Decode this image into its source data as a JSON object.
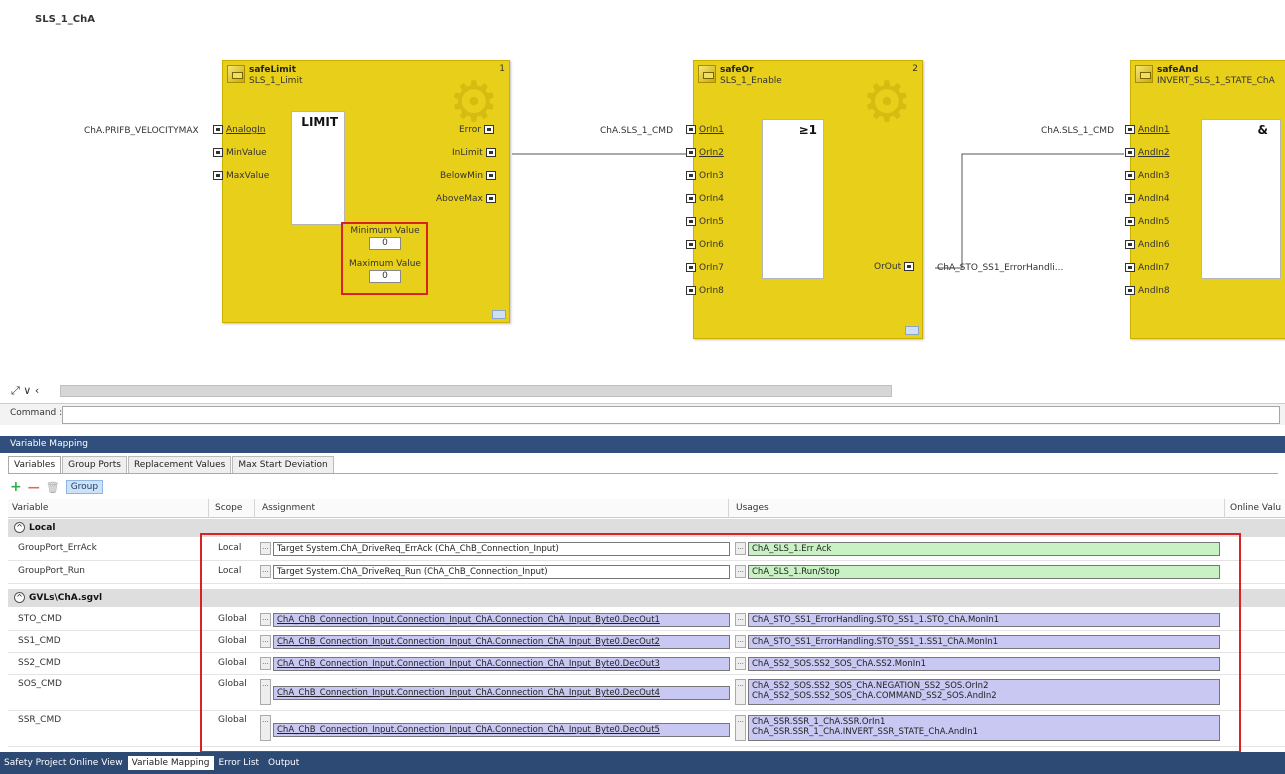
{
  "diagram": {
    "sheet_title": "SLS_1_ChA",
    "blocks": [
      {
        "type": "safeLimit",
        "instance": "SLS_1_Limit",
        "number": "1",
        "core_label": "LIMIT",
        "inputs": [
          "AnalogIn",
          "MinValue",
          "MaxValue"
        ],
        "outputs": [
          "Error",
          "InLimit",
          "BelowMin",
          "AboveMax"
        ],
        "params": [
          {
            "label": "Minimum Value",
            "value": "0"
          },
          {
            "label": "Maximum Value",
            "value": "0"
          }
        ],
        "input_connections": [
          "ChA.PRIFB_VELOCITYMAX"
        ]
      },
      {
        "type": "safeOr",
        "instance": "SLS_1_Enable",
        "number": "2",
        "core_label": "≥1",
        "inputs": [
          "OrIn1",
          "OrIn2",
          "OrIn3",
          "OrIn4",
          "OrIn5",
          "OrIn6",
          "OrIn7",
          "OrIn8"
        ],
        "output": "OrOut",
        "input_connections": [
          "ChA.SLS_1_CMD"
        ],
        "output_connection": "ChA_STO_SS1_ErrorHandli..."
      },
      {
        "type": "safeAnd",
        "instance": "INVERT_SLS_1_STATE_ChA",
        "core_label": "&",
        "inputs": [
          "AndIn1",
          "AndIn2",
          "AndIn3",
          "AndIn4",
          "AndIn5",
          "AndIn6",
          "AndIn7",
          "AndIn8"
        ],
        "input_connections": [
          "ChA.SLS_1_CMD"
        ]
      }
    ]
  },
  "command": {
    "label": "Command :"
  },
  "panel": {
    "title": "Variable Mapping",
    "tabs": [
      "Variables",
      "Group Ports",
      "Replacement Values",
      "Max Start Deviation"
    ],
    "toolbar": {
      "add_icon": "+",
      "remove_icon": "—",
      "delete_icon": "🗑",
      "group_label": "Group"
    },
    "columns": [
      "Variable",
      "Scope",
      "Assignment",
      "Usages",
      "Online Valu"
    ],
    "groups": [
      {
        "name": "Local",
        "toggle": "^",
        "rows": [
          {
            "variable": "GroupPort_ErrAck",
            "scope": "Local",
            "assignment": "Target System.ChA_DriveReq_ErrAck (ChA_ChB_Connection_Input)",
            "usages": [
              "ChA_SLS_1.Err Ack"
            ]
          },
          {
            "variable": "GroupPort_Run",
            "scope": "Local",
            "assignment": "Target System.ChA_DriveReq_Run (ChA_ChB_Connection_Input)",
            "usages": [
              "ChA_SLS_1.Run/Stop"
            ]
          }
        ]
      },
      {
        "name": "GVLs\\ChA.sgvl",
        "toggle": "^",
        "rows": [
          {
            "variable": "STO_CMD",
            "scope": "Global",
            "assignment": "ChA_ChB_Connection_Input.Connection_Input_ChA.Connection_ChA_Input_Byte0.DecOut1",
            "usages": [
              "ChA_STO_SS1_ErrorHandling.STO_SS1_1.STO_ChA.MonIn1"
            ]
          },
          {
            "variable": "SS1_CMD",
            "scope": "Global",
            "assignment": "ChA_ChB_Connection_Input.Connection_Input_ChA.Connection_ChA_Input_Byte0.DecOut2",
            "usages": [
              "ChA_STO_SS1_ErrorHandling.STO_SS1_1.SS1_ChA.MonIn1"
            ]
          },
          {
            "variable": "SS2_CMD",
            "scope": "Global",
            "assignment": "ChA_ChB_Connection_Input.Connection_Input_ChA.Connection_ChA_Input_Byte0.DecOut3",
            "usages": [
              "ChA_SS2_SOS.SS2_SOS_ChA.SS2.MonIn1"
            ]
          },
          {
            "variable": "SOS_CMD",
            "scope": "Global",
            "assignment": "ChA_ChB_Connection_Input.Connection_Input_ChA.Connection_ChA_Input_Byte0.DecOut4",
            "usages": [
              "ChA_SS2_SOS.SS2_SOS_ChA.NEGATION_SS2_SOS.OrIn2",
              "ChA_SS2_SOS.SS2_SOS_ChA.COMMAND_SS2_SOS.AndIn2"
            ]
          },
          {
            "variable": "SSR_CMD",
            "scope": "Global",
            "assignment": "ChA_ChB_Connection_Input.Connection_Input_ChA.Connection_ChA_Input_Byte0.DecOut5",
            "usages": [
              "ChA_SSR.SSR_1_ChA.SSR.OrIn1",
              "ChA_SSR.SSR_1_ChA.INVERT_SSR_STATE_ChA.AndIn1"
            ]
          }
        ]
      }
    ],
    "dots_label": "..."
  },
  "bottom_tabs": [
    "Safety Project Online View",
    "Variable Mapping",
    "Error List",
    "Output"
  ],
  "colors": {
    "block": "#e8cf1a",
    "local_usage": "#c9f2c4",
    "global_field": "#c8c8f2",
    "highlight": "#d62424",
    "panel_header": "#314f7c"
  }
}
